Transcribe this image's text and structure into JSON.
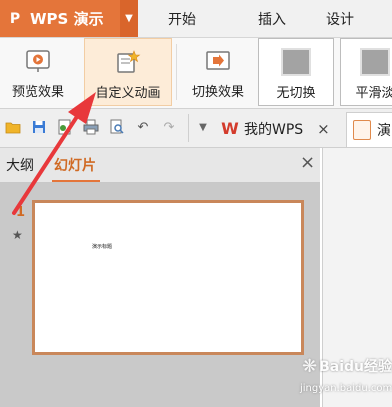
{
  "app": {
    "title": "WPS 演示"
  },
  "menu": {
    "tabs": [
      "开始",
      "插入",
      "设计"
    ]
  },
  "ribbon": {
    "preview_label": "预览效果",
    "custom_anim_label": "自定义动画",
    "switch_effect_label": "切换效果",
    "no_switch_label": "无切换",
    "smooth_label": "平滑淡"
  },
  "doc_tabs": {
    "mywps": "我的WPS",
    "active": "演"
  },
  "panel": {
    "outline_tab": "大纲",
    "slides_tab": "幻灯片",
    "slide_number": "1",
    "slide_text": "演示标题"
  },
  "watermark": {
    "brand": "Baidu经验",
    "url": "jingyan.baidu.com"
  },
  "colors": {
    "accent": "#e4753a",
    "arrow": "#e8383b",
    "selected": "#fdecd8"
  }
}
